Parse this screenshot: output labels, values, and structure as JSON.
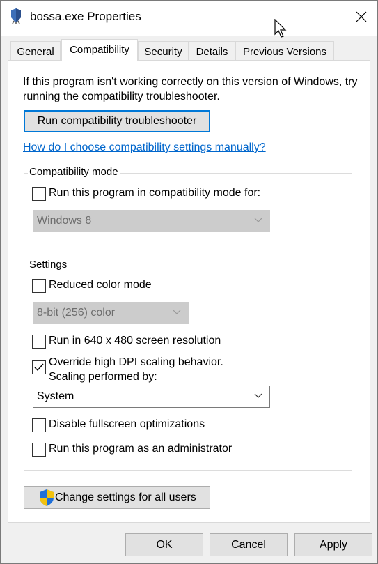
{
  "window": {
    "title": "bossa.exe Properties"
  },
  "tabs": [
    {
      "label": "General"
    },
    {
      "label": "Compatibility"
    },
    {
      "label": "Security"
    },
    {
      "label": "Details"
    },
    {
      "label": "Previous Versions"
    }
  ],
  "compat": {
    "intro_line1": "If this program isn't working correctly on this version of Windows, try",
    "intro_line2": "running the compatibility troubleshooter.",
    "troubleshooter_button": "Run compatibility troubleshooter",
    "manual_link": "How do I choose compatibility settings manually?",
    "mode_group_label": "Compatibility mode",
    "mode_checkbox_label": "Run this program in compatibility mode for:",
    "mode_checked": false,
    "mode_select_value": "Windows 8"
  },
  "settings": {
    "group_label": "Settings",
    "reduced_color_label": "Reduced color mode",
    "reduced_color_checked": false,
    "color_select_value": "8-bit (256) color",
    "resolution_label": "Run in 640 x 480 screen resolution",
    "resolution_checked": false,
    "dpi_label_line1": "Override high DPI scaling behavior.",
    "dpi_label_line2": "Scaling performed by:",
    "dpi_checked": true,
    "dpi_select_value": "System",
    "fullscreen_label": "Disable fullscreen optimizations",
    "fullscreen_checked": false,
    "admin_label": "Run this program as an administrator",
    "admin_checked": false
  },
  "change_all_button": "Change settings for all users",
  "footer": {
    "ok": "OK",
    "cancel": "Cancel",
    "apply": "Apply"
  },
  "colors": {
    "accent": "#0078d7",
    "link": "#0066cc",
    "disabled_select": "#cccccc"
  }
}
